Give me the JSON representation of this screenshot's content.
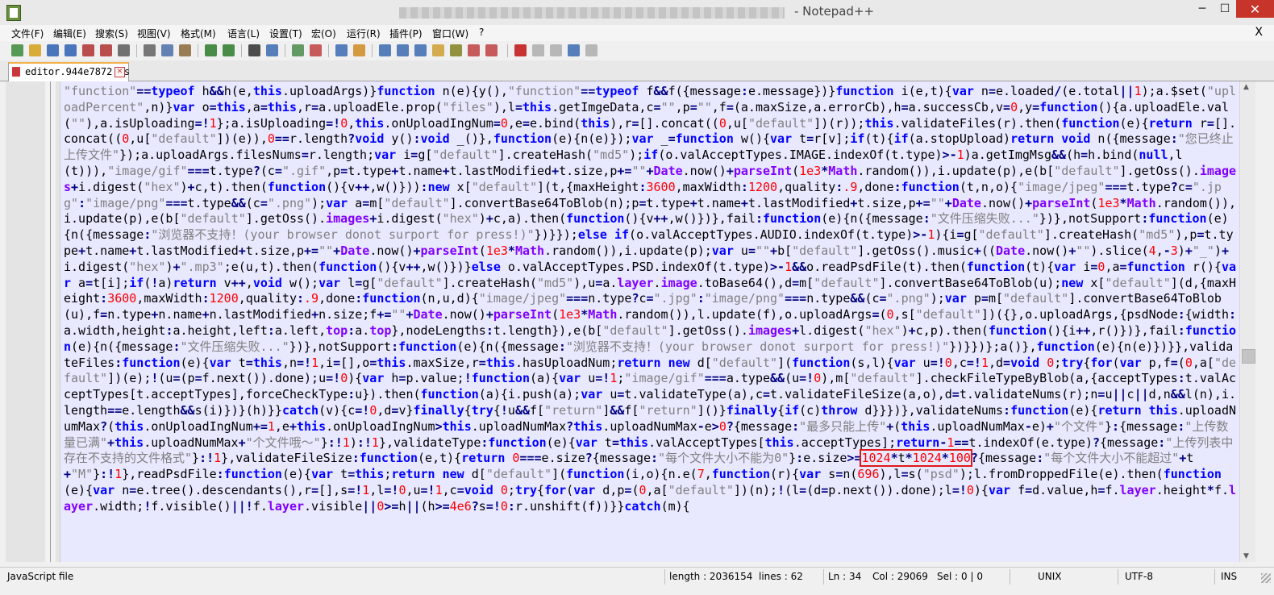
{
  "window": {
    "title": "- Notepad++",
    "minimize_label": "─",
    "maximize_label": "☐",
    "close_label": "✕"
  },
  "menu": {
    "items": [
      "文件(F)",
      "编辑(E)",
      "搜索(S)",
      "视图(V)",
      "格式(M)",
      "语言(L)",
      "设置(T)",
      "宏(O)",
      "运行(R)",
      "插件(P)",
      "窗口(W)",
      "?"
    ],
    "close_label": "X"
  },
  "toolbar": {
    "icons": [
      "new-file-icon",
      "open-file-icon",
      "save-icon",
      "save-all-icon",
      "close-icon",
      "close-all-icon",
      "print-icon",
      "cut-icon",
      "copy-icon",
      "paste-icon",
      "undo-icon",
      "redo-icon",
      "find-icon",
      "replace-icon",
      "zoom-in-icon",
      "zoom-out-icon",
      "sync-vertical-icon",
      "sync-horizontal-icon",
      "word-wrap-icon",
      "show-all-chars-icon",
      "indent-guide-icon",
      "user-language-icon",
      "doc-map-icon",
      "function-list-icon",
      "folder-workspace-icon",
      "record-macro-icon",
      "stop-record-icon",
      "playback-macro-icon",
      "run-macro-multiple-icon",
      "save-macro-icon"
    ]
  },
  "tab": {
    "label": "editor.944e7872.js",
    "close_label": "✕"
  },
  "editor": {
    "lines": [
      "\"function\"==typeof h&&h(e,this.uploadArgs)}function n(e){y(),\"function\"==typeof f&&f({message:e.message})}function i(e,t){var n=e.loaded/(e.total||1);a.$set(\"uploadPercent\",n)}var o=this,a=this,r=a.uploadEle.prop(\"files\"),l=this.getImgeData,c=\"\",p=\"\",f=(a.maxSize,a.errorCb),h=a.successCb,v=0,y=function(){a.uploadEle.val(\"\"),a.isUploading=!1};a.isUploading=!0,this.onUploadIngNum=0,e=e.bind(this),r=[].concat((0,u[\"default\"])(r));this.validateFiles(r).then(function(e){return r=[].concat((0,u[\"default\"])(e)),0==r.length?void y():void _()},function(e){n(e)});var _=function w(){var t=r[v];if(t){if(a.stopUpload)return void n({message:\"您已终止上传文件\"});a.uploadArgs.filesNums=r.length;var i=g[\"default\"].createHash(\"md5\");if(o.valAcceptTypes.IMAGE.indexOf(t.type)>-1)a.getImgMsg&&(h=h.bind(null,l(t))),\"image/gif\"===t.type?(c=\".gif\",p=t.type+t.name+t.lastModified+t.size,p+=\"\"+Date.now()+parseInt(1e3*Math.random()),i.update(p),e(b[\"default\"].getOss().images+i.digest(\"hex\")+c,t).then(function(){v++,w()})):new x[\"default\"](t,{maxHeight:3600,maxWidth:1200,quality:.9,done:function(t,n,o){\"image/jpeg\"===t.type?c=\".jpg\":\"image/png\"===t.type&&(c=\".png\");var a=m[\"default\"].convertBase64ToBlob(n);p=t.type+t.name+t.lastModified+t.size,p+=\"\"+Date.now()+parseInt(1e3*Math.random()),i.update(p),e(b[\"default\"].getOss().images+i.digest(\"hex\")+c,a).then(function(){v++,w()})},fail:function(e){n({message:\"文件压缩失败...\"})},notSupport:function(e){n({message:\"浏览器不支持！(your browser donot surport for press!)\"})}});else if(o.valAcceptTypes.AUDIO.indexOf(t.type)>-1){i=g[\"default\"].createHash(\"md5\"),p=t.type+t.name+t.lastModified+t.size,p+=\"\"+Date.now()+parseInt(1e3*Math.random()),i.update(p);var u=\"\"+b[\"default\"].getOss().music+((Date.now()+\"\").slice(4,-3)+\"_\")+i.digest(\"hex\")+\".mp3\";e(u,t).then(function(){v++,w()})}else o.valAcceptTypes.PSD.indexOf(t.type)>-1&&o.readPsdFile(t).then(function(t){var i=0,a=function r(){var a=t[i];if(!a)return v++,void w();var l=g[\"default\"].createHash(\"md5\"),u=a.layer.image.toBase64(),d=m[\"default\"].convertBase64ToBlob(u);new x[\"default\"](d,{maxHeight:3600,maxWidth:1200,quality:.9,done:function(n,u,d){\"image/jpeg\"===n.type?c=\".jpg\":\"image/png\"===n.type&&(c=\".png\");var p=m[\"default\"].convertBase64ToBlob(u),f=n.type+n.name+n.lastModified+n.size;f+=\"\"+Date.now()+parseInt(1e3*Math.random()),l.update(f),o.uploadArgs=(0,s[\"default\"])({},o.uploadArgs,{psdNode:{width:a.width,height:a.height,left:a.left,top:a.top},nodeLengths:t.length}),e(b[\"default\"].getOss().images+l.digest(\"hex\")+c,p).then(function(){i++,r()})},fail:function(e){n({message:\"文件压缩失败...\"})},notSupport:function(e){n({message:\"浏览器不支持！(your browser donot surport for press!)\"})}})};a()},function(e){n(e)})}},validateFiles:function(e){var t=this,n=!1,i=[],o=this.maxSize,r=this.hasUploadNum;return new d[\"default\"](function(s,l){var u=!0,c=!1,d=void 0;try{for(var p,f=(0,a[\"default\"])(e);!(u=(p=f.next()).done);u=!0){var h=p.value;!function(a){var u=!1;\"image/gif\"===a.type&&(u=!0),m[\"default\"].checkFileTypeByBlob(a,{acceptTypes:t.valAcceptTypes[t.acceptTypes],forceCheckType:u}).then(function(a){i.push(a);var u=t.validateType(a),c=t.validateFileSize(a,o),d=t.validateNums(r);n=u||c||d,n&&l(n),i.length==e.length&&s(i)})}(h)}}catch(v){c=!0,d=v}finally{try{!u&&f[\"return\"]&&f[\"return\"]()}finally{if(c)throw d}}})},validateNums:function(e){return this.uploadNumMax?(this.onUploadIngNum+=1,e+this.onUploadIngNum>this.uploadNumMax?this.uploadNumMax-e>0?{message:\"最多只能上传\"+(this.uploadNumMax-e)+\"个文件\"}:{message:\"上传数量已满\"+this.uploadNumMax+\"个文件哦～\"}:!1):!1},validateType:function(e){var t=this.valAcceptTypes[this.acceptTypes];return-1==t.indexOf(e.type)?{message:\"上传列表中存在不支持的文件格式\"}:!1},validateFileSize:function(e,t){return 0===e.size?{message:\"每个文件大小不能为0\"}:e.size>=1024*t*1024*100?{message:\"每个文件大小不能超过\"+t+\"M\"}:!1},readPsdFile:function(e){var t=this;return new d[\"default\"](function(i,o){n.e(7,function(r){var s=n(696),l=s(\"psd\");l.fromDroppedFile(e).then(function(e){var n=e.tree().descendants(),r=[],s=!1,l=!0,u=!1,c=void 0;try{for(var d,p=(0,a[\"default\"])(n);!(l=(d=p.next()).done);l=!0){var f=d.value,h=f.layer.height*f.layer.width;!f.visible()||!f.layer.visible||0>=h||(h>=4e6?s=!0:r.unshift(f))}}catch(m){"
    ]
  },
  "status": {
    "file_type": "JavaScript file",
    "length": "length : 2036154",
    "lines": "lines : 62",
    "ln": "Ln : 34",
    "col": "Col : 29069",
    "sel": "Sel : 0 | 0",
    "eol": "UNIX",
    "encoding": "UTF-8",
    "mode": "INS"
  },
  "colors": {
    "editor_bg": "#e8e8ff",
    "keyword": "#0000ff",
    "string": "#808080",
    "number": "#ff0000",
    "operator": "#000080",
    "builtin": "#8000ff",
    "highlight_box": "#e01818"
  }
}
